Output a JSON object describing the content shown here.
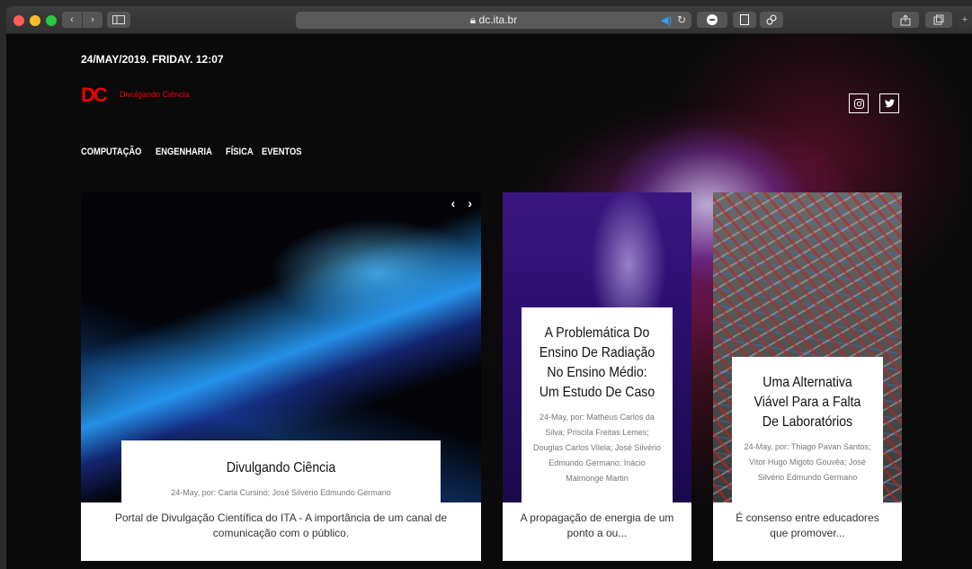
{
  "browser": {
    "url": "dc.ita.br",
    "lock_icon": "lock-icon",
    "audio_icon": "speaker-icon"
  },
  "site": {
    "datetime": "24/MAY/2019. FRIDAY. 12:07",
    "logo_mark": "DC",
    "logo_text": "Divulgando Ciência",
    "accent_color": "#e00000",
    "nav": [
      "COMPUTAÇÃO",
      "ENGENHARIA",
      "FÍSICA",
      "EVENTOS"
    ],
    "social": [
      "instagram-icon",
      "twitter-icon"
    ]
  },
  "slider": {
    "prev": "‹",
    "next": "›"
  },
  "cards": [
    {
      "title": "Divulgando Ciência",
      "meta": "24-May, por: Carla Cursino; José Silvério Edmundo Germano",
      "excerpt": "Portal de Divulgação Científica do ITA - A importância de um canal de comunicação com o público."
    },
    {
      "title": "A Problemática Do Ensino De Radiação No Ensino Médio: Um Estudo De Caso",
      "meta": "24-May, por: Matheus Carlos da Silva; Priscila Freitas Lemes; Douglas Carlos Vilela; José Silvério Edmundo Germano; Inácio Malmonge Martin",
      "excerpt": "A propagação de energia de um ponto a ou..."
    },
    {
      "title": "Uma Alternativa Viável Para a Falta De Laboratórios",
      "meta": "24-May, por: Thiago Pavan Santos; Vitor Hugo Migoto Gouvêa; José Silvério Edmundo Germano",
      "excerpt": "É consenso entre educadores que promover..."
    }
  ]
}
